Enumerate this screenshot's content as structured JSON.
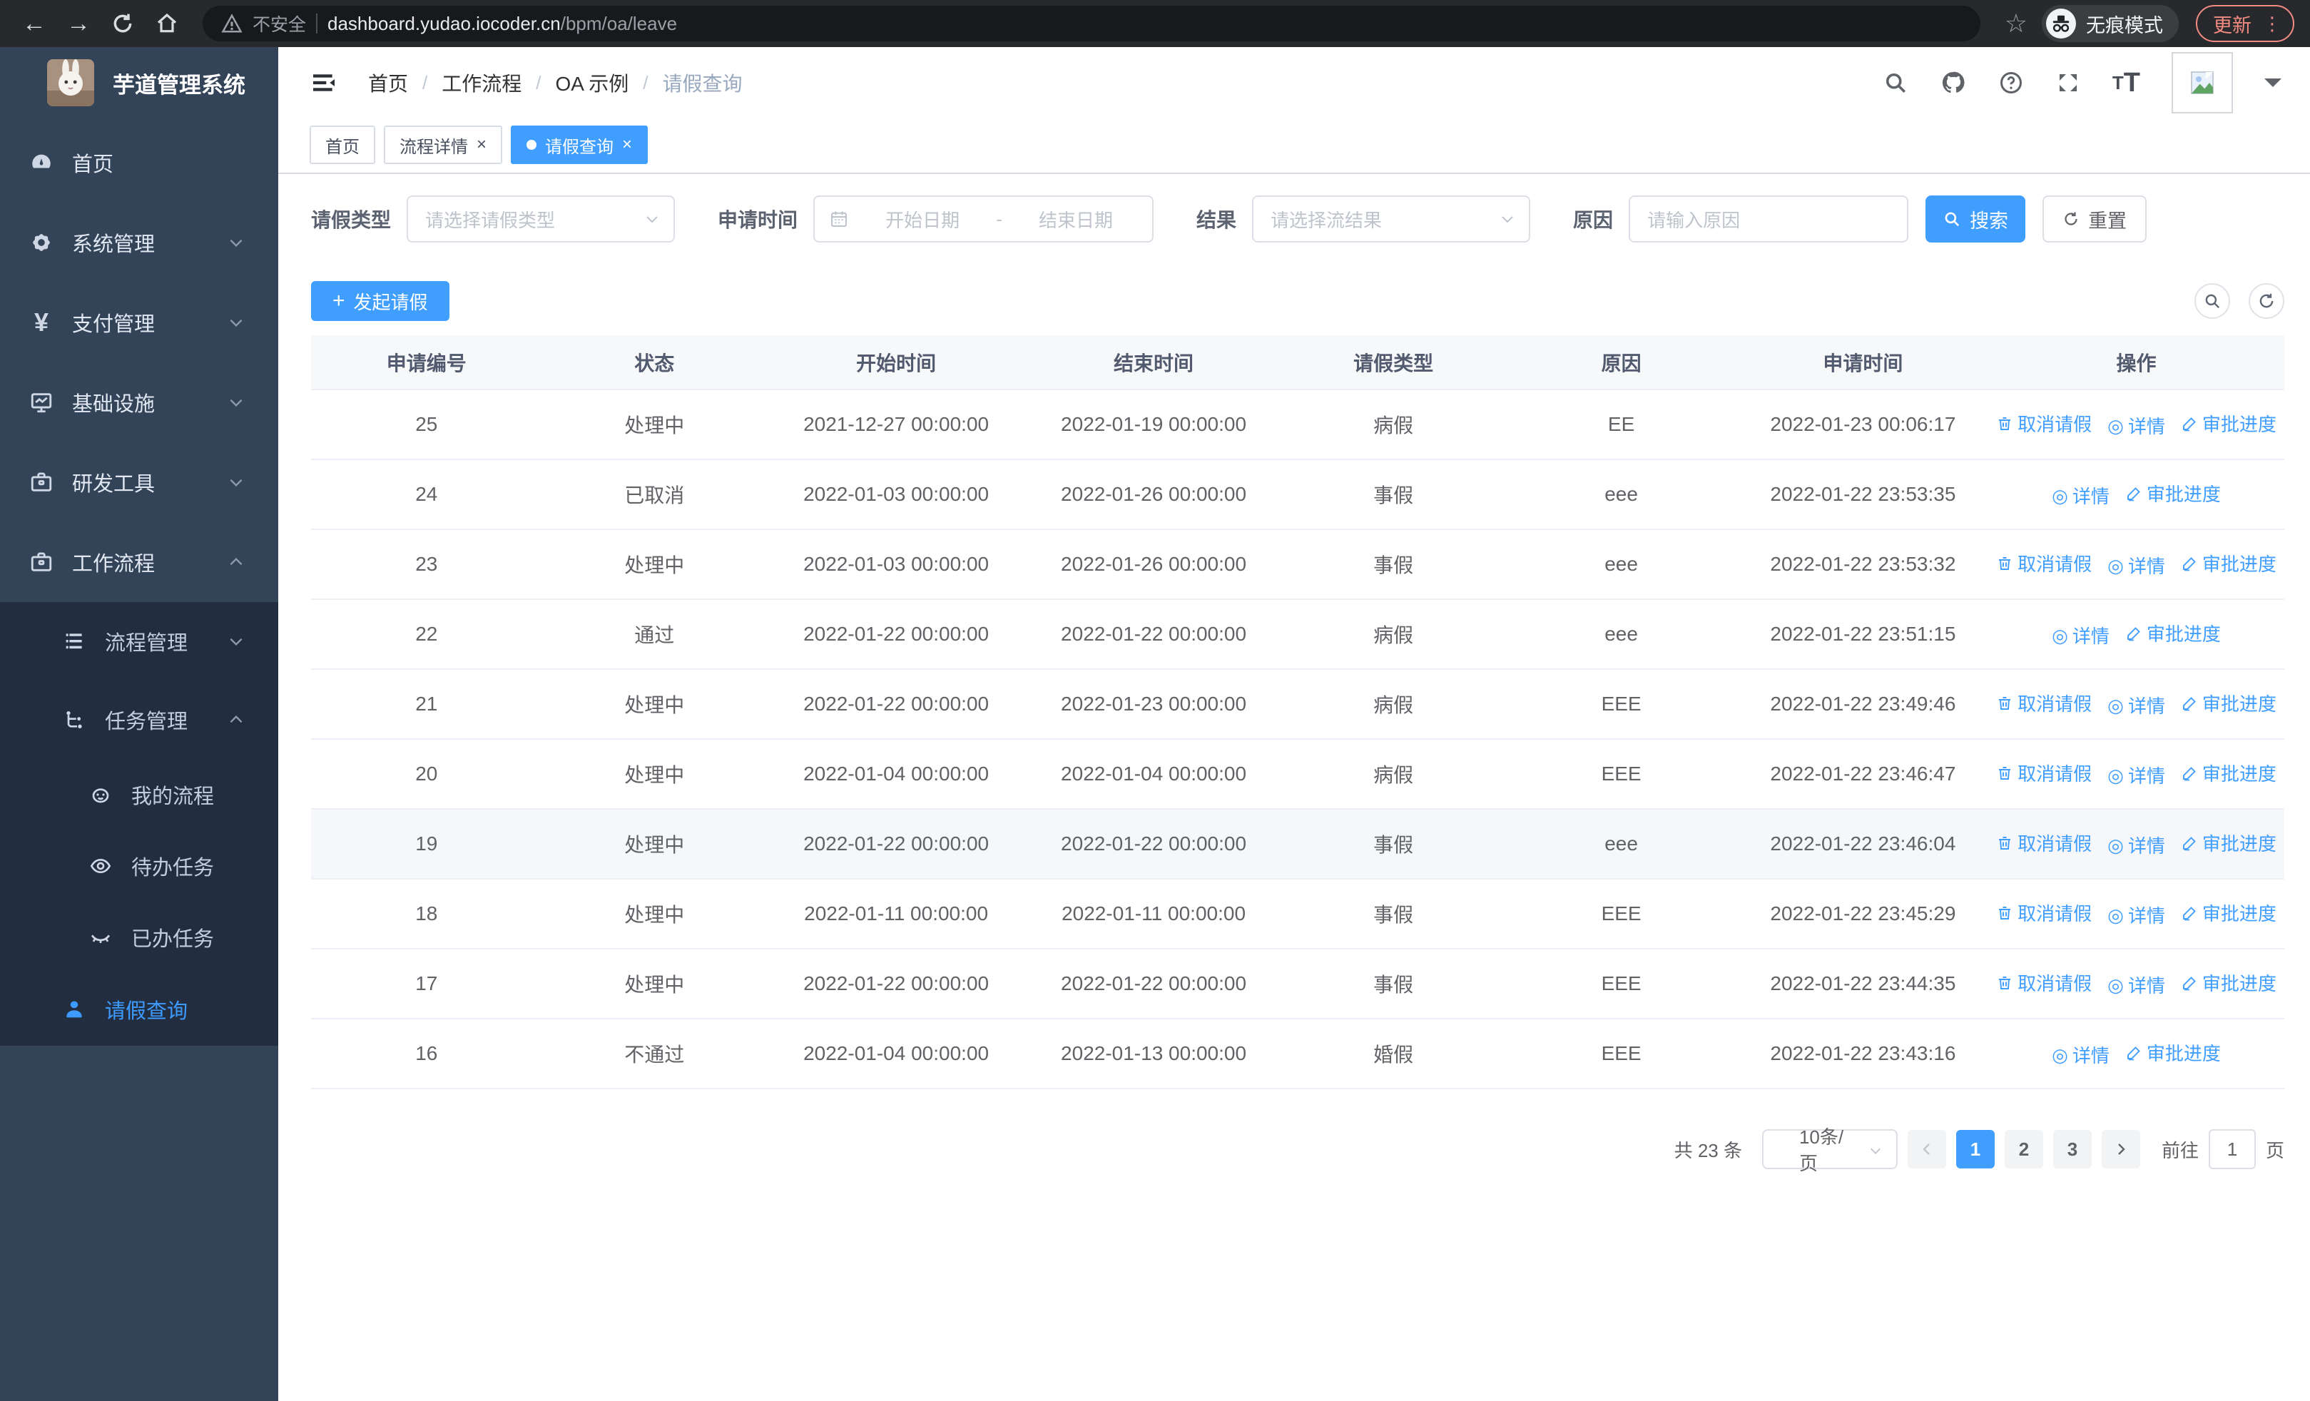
{
  "browser": {
    "security_label": "不安全",
    "url_host": "dashboard.yudao.iocoder.cn",
    "url_path": "/bpm/oa/leave",
    "incognito_label": "无痕模式",
    "update_label": "更新"
  },
  "sidebar": {
    "app_title": "芋道管理系统",
    "items": [
      {
        "label": "首页"
      },
      {
        "label": "系统管理"
      },
      {
        "label": "支付管理"
      },
      {
        "label": "基础设施"
      },
      {
        "label": "研发工具"
      },
      {
        "label": "工作流程"
      },
      {
        "label": "流程管理"
      },
      {
        "label": "任务管理"
      },
      {
        "label": "我的流程"
      },
      {
        "label": "待办任务"
      },
      {
        "label": "已办任务"
      },
      {
        "label": "请假查询"
      }
    ]
  },
  "header": {
    "breadcrumb": [
      "首页",
      "工作流程",
      "OA 示例",
      "请假查询"
    ]
  },
  "tabs": [
    {
      "label": "首页"
    },
    {
      "label": "流程详情"
    },
    {
      "label": "请假查询"
    }
  ],
  "filters": {
    "leave_type_label": "请假类型",
    "leave_type_placeholder": "请选择请假类型",
    "apply_time_label": "申请时间",
    "start_date_placeholder": "开始日期",
    "range_separator": "-",
    "end_date_placeholder": "结束日期",
    "result_label": "结果",
    "result_placeholder": "请选择流结果",
    "reason_label": "原因",
    "reason_placeholder": "请输入原因",
    "search_label": "搜索",
    "reset_label": "重置"
  },
  "toolbar": {
    "create_label": "发起请假"
  },
  "table": {
    "columns": [
      "申请编号",
      "状态",
      "开始时间",
      "结束时间",
      "请假类型",
      "原因",
      "申请时间",
      "操作"
    ],
    "action_labels": {
      "cancel": "取消请假",
      "detail": "详情",
      "progress": "审批进度"
    },
    "rows": [
      {
        "id": "25",
        "status": "处理中",
        "start_time": "2021-12-27 00:00:00",
        "end_time": "2022-01-19 00:00:00",
        "leave_type": "病假",
        "reason": "EE",
        "apply_time": "2022-01-23 00:06:17",
        "actions": [
          "cancel",
          "detail",
          "progress"
        ]
      },
      {
        "id": "24",
        "status": "已取消",
        "start_time": "2022-01-03 00:00:00",
        "end_time": "2022-01-26 00:00:00",
        "leave_type": "事假",
        "reason": "eee",
        "apply_time": "2022-01-22 23:53:35",
        "actions": [
          "detail",
          "progress"
        ]
      },
      {
        "id": "23",
        "status": "处理中",
        "start_time": "2022-01-03 00:00:00",
        "end_time": "2022-01-26 00:00:00",
        "leave_type": "事假",
        "reason": "eee",
        "apply_time": "2022-01-22 23:53:32",
        "actions": [
          "cancel",
          "detail",
          "progress"
        ]
      },
      {
        "id": "22",
        "status": "通过",
        "start_time": "2022-01-22 00:00:00",
        "end_time": "2022-01-22 00:00:00",
        "leave_type": "病假",
        "reason": "eee",
        "apply_time": "2022-01-22 23:51:15",
        "actions": [
          "detail",
          "progress"
        ]
      },
      {
        "id": "21",
        "status": "处理中",
        "start_time": "2022-01-22 00:00:00",
        "end_time": "2022-01-23 00:00:00",
        "leave_type": "病假",
        "reason": "EEE",
        "apply_time": "2022-01-22 23:49:46",
        "actions": [
          "cancel",
          "detail",
          "progress"
        ]
      },
      {
        "id": "20",
        "status": "处理中",
        "start_time": "2022-01-04 00:00:00",
        "end_time": "2022-01-04 00:00:00",
        "leave_type": "病假",
        "reason": "EEE",
        "apply_time": "2022-01-22 23:46:47",
        "actions": [
          "cancel",
          "detail",
          "progress"
        ]
      },
      {
        "id": "19",
        "status": "处理中",
        "start_time": "2022-01-22 00:00:00",
        "end_time": "2022-01-22 00:00:00",
        "leave_type": "事假",
        "reason": "eee",
        "apply_time": "2022-01-22 23:46:04",
        "actions": [
          "cancel",
          "detail",
          "progress"
        ],
        "highlighted": true
      },
      {
        "id": "18",
        "status": "处理中",
        "start_time": "2022-01-11 00:00:00",
        "end_time": "2022-01-11 00:00:00",
        "leave_type": "事假",
        "reason": "EEE",
        "apply_time": "2022-01-22 23:45:29",
        "actions": [
          "cancel",
          "detail",
          "progress"
        ]
      },
      {
        "id": "17",
        "status": "处理中",
        "start_time": "2022-01-22 00:00:00",
        "end_time": "2022-01-22 00:00:00",
        "leave_type": "事假",
        "reason": "EEE",
        "apply_time": "2022-01-22 23:44:35",
        "actions": [
          "cancel",
          "detail",
          "progress"
        ]
      },
      {
        "id": "16",
        "status": "不通过",
        "start_time": "2022-01-04 00:00:00",
        "end_time": "2022-01-13 00:00:00",
        "leave_type": "婚假",
        "reason": "EEE",
        "apply_time": "2022-01-22 23:43:16",
        "actions": [
          "detail",
          "progress"
        ]
      }
    ]
  },
  "pagination": {
    "total_label": "共 23 条",
    "page_size": "10条/页",
    "pages": [
      "1",
      "2",
      "3"
    ],
    "active_page": "1",
    "goto_label": "前往",
    "goto_value": "1",
    "page_unit": "页"
  },
  "colors": {
    "primary": "#409eff",
    "sidebar_bg": "#334459",
    "submenu_bg": "#222e40"
  }
}
